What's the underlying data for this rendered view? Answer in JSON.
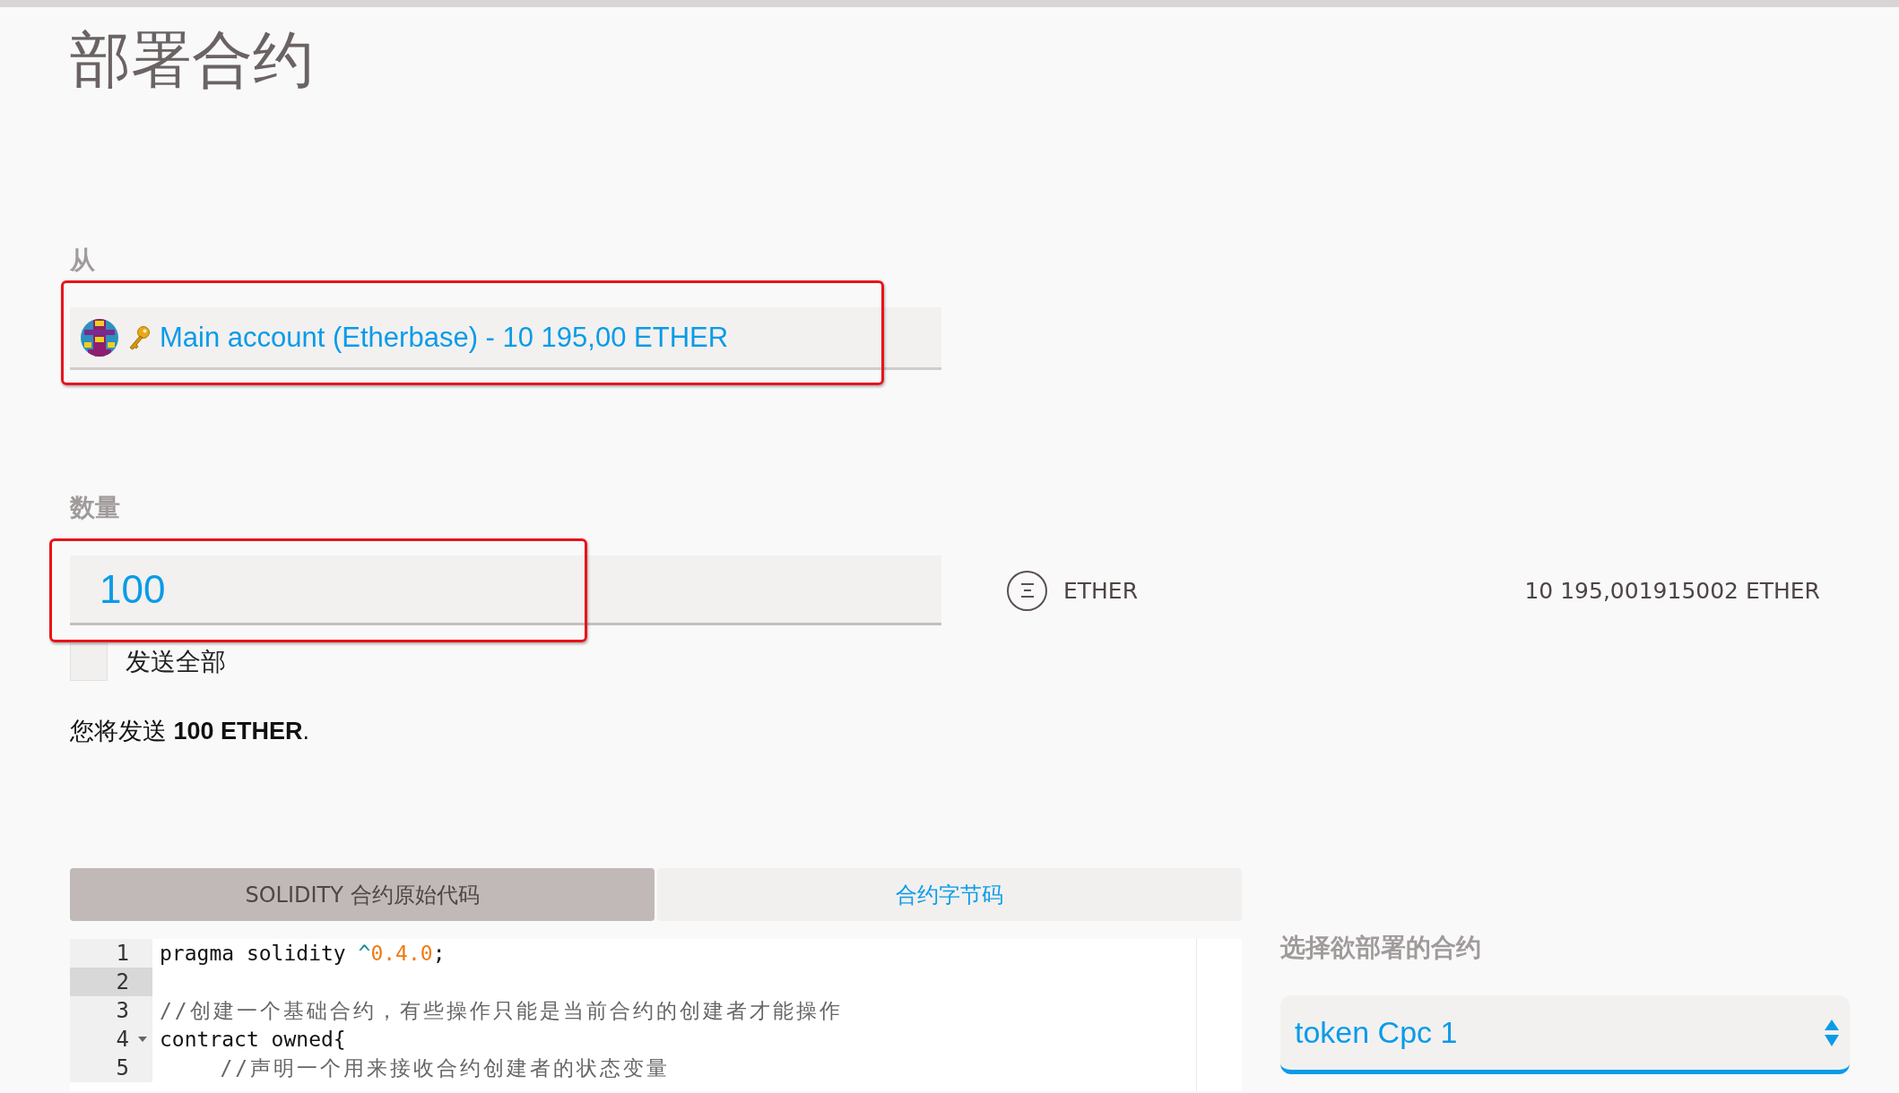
{
  "title": "部署合约",
  "from": {
    "label": "从",
    "account": "Main account (Etherbase) - 10 195,00 ETHER",
    "highlighted": true
  },
  "amount": {
    "label": "数量",
    "value": "100",
    "highlighted": true,
    "unit": "ETHER",
    "balance": "10 195,001915002 ETHER",
    "send_all": {
      "label": "发送全部",
      "checked": false
    },
    "summary": "您将发送 **100 ETHER**."
  },
  "tabs": [
    {
      "label": "SOLIDITY 合约原始代码",
      "selected": true
    },
    {
      "label": "合约字节码",
      "selected": false
    }
  ],
  "code_lines": [
    {
      "number": "1",
      "active": false,
      "foldable": false,
      "segments": [
        {
          "kind": "plain",
          "text": "pragma solidity "
        },
        {
          "kind": "operator",
          "text": "^"
        },
        {
          "kind": "number",
          "text": "0.4.0"
        },
        {
          "kind": "plain",
          "text": ";"
        }
      ]
    },
    {
      "number": "2",
      "active": true,
      "foldable": false
    },
    {
      "number": "3",
      "active": false,
      "foldable": false,
      "segments": [
        {
          "kind": "comment",
          "text": "//创建一个基础合约，有些操作只能是当前合约的创建者才能操作"
        }
      ]
    },
    {
      "number": "4",
      "active": false,
      "foldable": true,
      "segments": [
        {
          "kind": "plain",
          "text": "contract owned{"
        }
      ]
    },
    {
      "number": "5",
      "active": false,
      "foldable": false,
      "segments": [
        {
          "kind": "comment",
          "text": "    //声明一个用来接收合约创建者的状态变量"
        }
      ]
    }
  ],
  "contract_select": {
    "label": "选择欲部署的合约",
    "value": "token Cpc 1"
  }
}
